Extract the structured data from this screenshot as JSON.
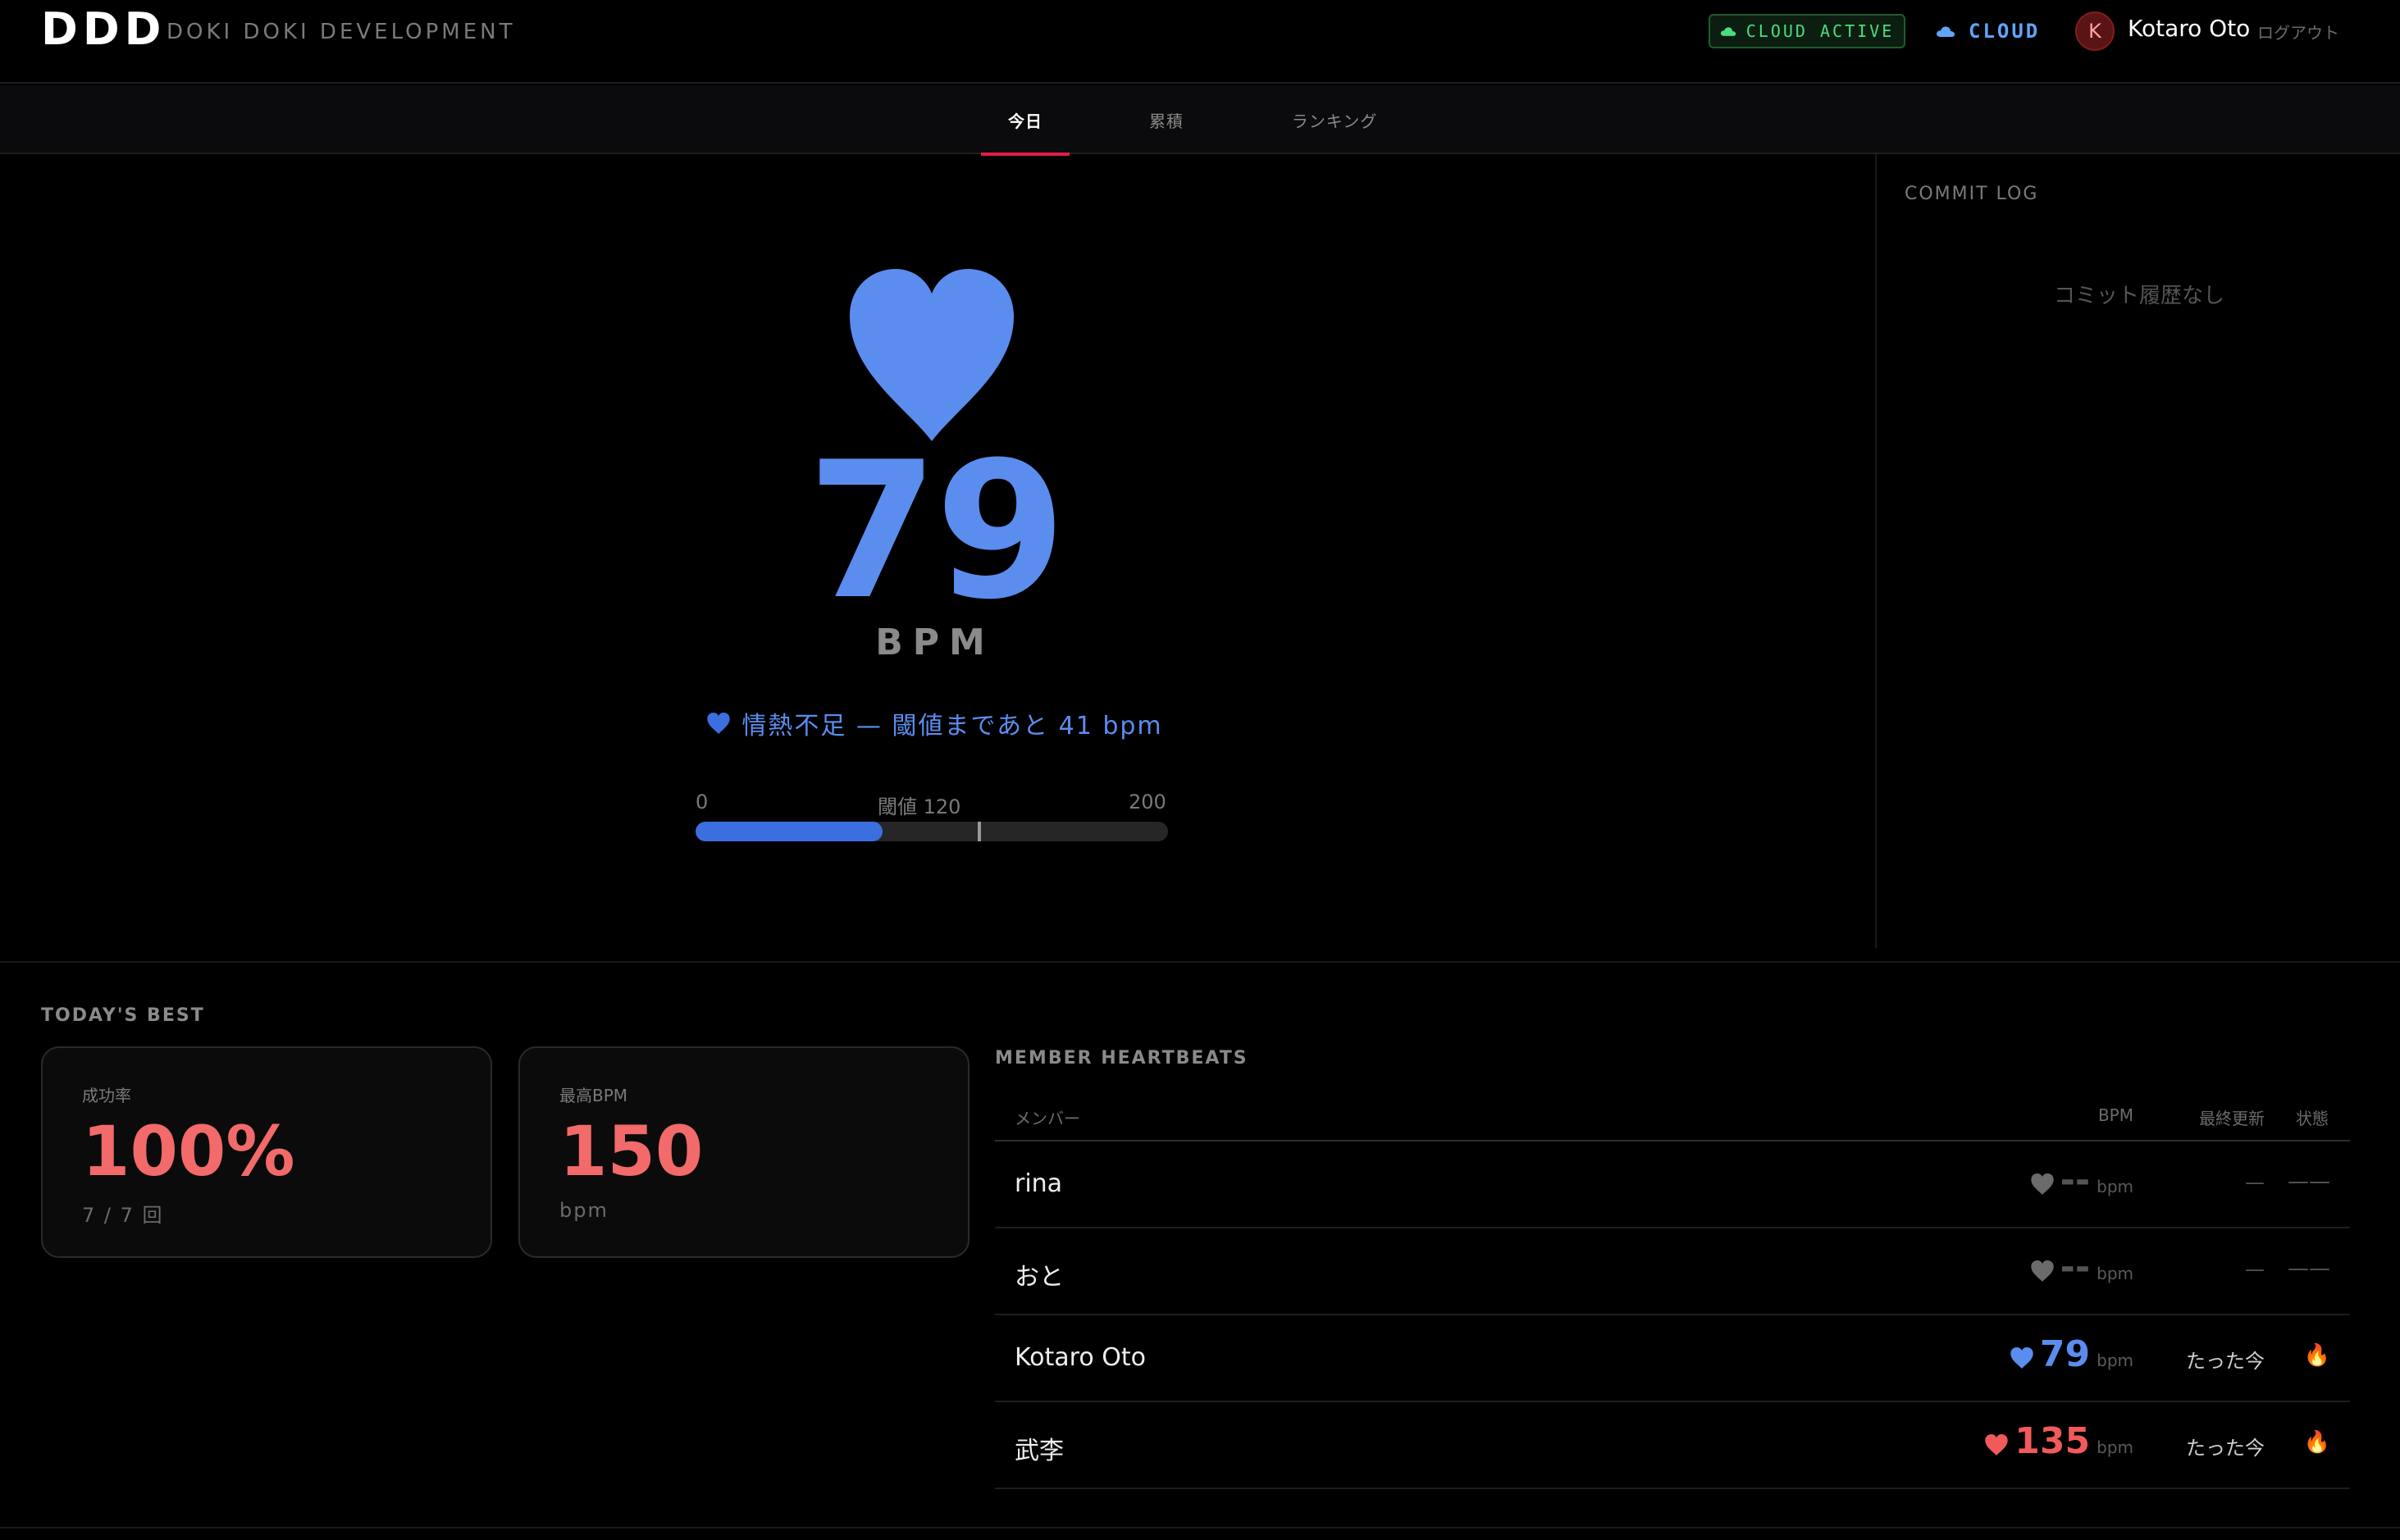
{
  "header": {
    "logo": "DDD",
    "subtitle": "DOKI DOKI DEVELOPMENT",
    "cloud_active": "CLOUD ACTIVE",
    "cloud_link": "CLOUD",
    "avatar_initial": "K",
    "user_name": "Kotaro Oto",
    "logout": "ログアウト"
  },
  "tabs": [
    {
      "label": "今日",
      "active": true
    },
    {
      "label": "累積",
      "active": false
    },
    {
      "label": "ランキング",
      "active": false
    }
  ],
  "hero": {
    "bpm": "79",
    "unit": "BPM",
    "status_text": "情熱不足 — 閾値まであと 41 bpm",
    "bar_min": "0",
    "bar_threshold_label": "閾値 120",
    "bar_max": "200",
    "bar_value": 79,
    "bar_threshold": 120,
    "bar_range_max": 200,
    "accent_color": "#5b8def"
  },
  "commit_log": {
    "title": "COMMIT LOG",
    "empty": "コミット履歴なし"
  },
  "todays_best": {
    "title": "TODAY'S BEST",
    "cards": [
      {
        "label": "成功率",
        "value": "100%",
        "sub": "7 / 7 回"
      },
      {
        "label": "最高BPM",
        "value": "150",
        "sub": "bpm"
      }
    ]
  },
  "members": {
    "title": "MEMBER HEARTBEATS",
    "columns": {
      "member": "メンバー",
      "bpm": "BPM",
      "updated": "最終更新",
      "status": "状態"
    },
    "rows": [
      {
        "name": "rina",
        "bpm": "--",
        "unit": "bpm",
        "updated": "—",
        "status": "——",
        "heart": "gray"
      },
      {
        "name": "おと",
        "bpm": "--",
        "unit": "bpm",
        "updated": "—",
        "status": "——",
        "heart": "gray"
      },
      {
        "name": "Kotaro Oto",
        "bpm": "79",
        "unit": "bpm",
        "updated": "たった今",
        "status": "🔥",
        "heart": "blue"
      },
      {
        "name": "武李",
        "bpm": "135",
        "unit": "bpm",
        "updated": "たった今",
        "status": "🔥",
        "heart": "red"
      }
    ]
  }
}
